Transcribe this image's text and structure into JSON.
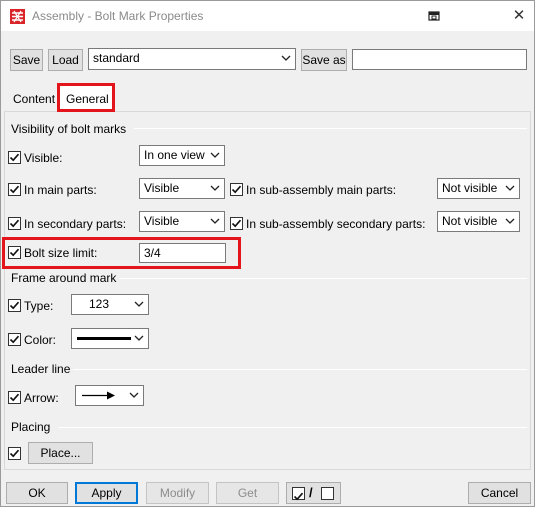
{
  "window": {
    "title": "Assembly - Bolt Mark Properties"
  },
  "toolbar": {
    "save_label": "Save",
    "load_label": "Load",
    "preset_value": "standard",
    "save_as_label": "Save as",
    "save_as_value": ""
  },
  "tabs": [
    {
      "label": "Content",
      "active": false
    },
    {
      "label": "General",
      "active": true
    }
  ],
  "visibility": {
    "section_title": "Visibility of bolt marks",
    "visible_label": "Visible:",
    "visible_value": "In one view",
    "main_parts_label": "In main parts:",
    "main_parts_value": "Visible",
    "sub_main_label": "In sub-assembly main parts:",
    "sub_main_value": "Not visible",
    "secondary_label": "In secondary parts:",
    "secondary_value": "Visible",
    "sub_secondary_label": "In sub-assembly secondary parts:",
    "sub_secondary_value": "Not visible",
    "bolt_size_label": "Bolt size limit:",
    "bolt_size_value": "3/4"
  },
  "frame": {
    "section_title": "Frame around mark",
    "type_label": "Type:",
    "type_value": "123",
    "color_label": "Color:"
  },
  "leader": {
    "section_title": "Leader line",
    "arrow_label": "Arrow:"
  },
  "placing": {
    "section_title": "Placing",
    "place_label": "Place..."
  },
  "buttons": {
    "ok": "OK",
    "apply": "Apply",
    "modify": "Modify",
    "get": "Get",
    "toggle_separator": "/",
    "cancel": "Cancel"
  },
  "colors": {
    "highlight": "#e3151a",
    "accent": "#0078d7",
    "title_text": "#8a8a8a"
  }
}
